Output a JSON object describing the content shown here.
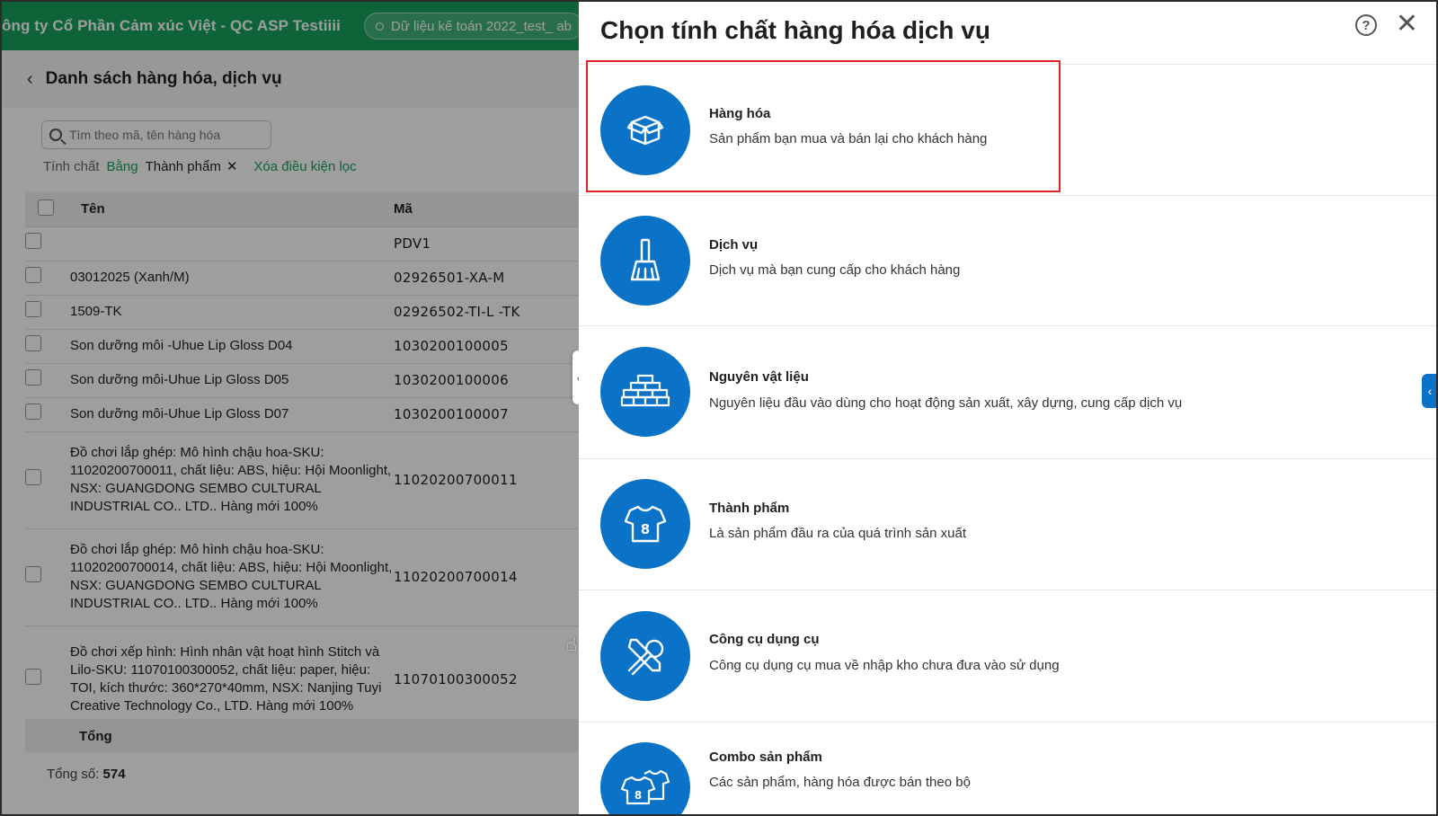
{
  "app": {
    "company": "ông ty Cổ Phần Cảm xúc Việt - QC ASP Testiiii",
    "database": "Dữ liệu kế toán 2022_test_ ab",
    "page_title": "Danh sách hàng hóa, dịch vụ",
    "search": {
      "placeholder": "Tìm theo mã, tên hàng hóa"
    },
    "filter": {
      "label": "Tính chất",
      "operator": "Bằng",
      "value": "Thành phẩm",
      "clear": "Xóa điều kiện lọc"
    },
    "columns": {
      "name": "Tên",
      "code": "Mã"
    },
    "rows": [
      {
        "name": "",
        "code": "PDV1"
      },
      {
        "name": "03012025 (Xanh/M)",
        "code": "02926501-XA-M"
      },
      {
        "name": "1509-TK",
        "code": "02926502-TI-L -TK"
      },
      {
        "name": "Son dưỡng môi -Uhue Lip Gloss D04",
        "code": "1030200100005"
      },
      {
        "name": "Son dưỡng môi-Uhue Lip Gloss D05",
        "code": "1030200100006"
      },
      {
        "name": "Son dưỡng môi-Uhue Lip Gloss D07",
        "code": "1030200100007"
      },
      {
        "name": "Đồ chơi lắp ghép: Mô hình chậu hoa-SKU: 11020200700011, chất liệu: ABS, hiệu: Hội Moonlight, NSX: GUANGDONG SEMBO CULTURAL INDUSTRIAL CO.. LTD.. Hàng mới 100%",
        "code": "11020200700011"
      },
      {
        "name": "Đồ chơi lắp ghép: Mô hình chậu hoa-SKU: 11020200700014, chất liệu: ABS, hiệu: Hội Moonlight, NSX: GUANGDONG SEMBO CULTURAL INDUSTRIAL CO.. LTD.. Hàng mới 100%",
        "code": "11020200700014"
      },
      {
        "name": "Đồ chơi xếp hình: Hình nhân vật hoạt hình Stitch và Lilo-SKU: 11070100300052, chất liệu: paper, hiệu: TOI, kích thước: 360*270*40mm, NSX: Nanjing Tuyi Creative Technology Co., LTD. Hàng mới 100%",
        "code": "11070100300052"
      }
    ],
    "total_label": "Tổng",
    "count_label": "Tổng số:",
    "count_value": "574"
  },
  "drawer": {
    "title": "Chọn tính chất hàng hóa dịch vụ",
    "options": [
      {
        "name": "Hàng hóa",
        "desc": "Sản phẩm bạn mua và bán lại cho khách hàng",
        "icon": "box-icon"
      },
      {
        "name": "Dịch vụ",
        "desc": "Dịch vụ mà bạn cung cấp cho khách hàng",
        "icon": "broom-icon"
      },
      {
        "name": "Nguyên vật liệu",
        "desc": "Nguyên liệu đầu vào dùng cho hoạt động sản xuất, xây dựng, cung cấp dịch vụ",
        "icon": "bricks-icon"
      },
      {
        "name": "Thành phẩm",
        "desc": "Là sản phẩm đầu ra của quá trình sản xuất",
        "icon": "shirt-icon"
      },
      {
        "name": "Công cụ dụng cụ",
        "desc": "Công cụ dụng cụ mua về nhập kho chưa đưa vào sử dụng",
        "icon": "tools-icon"
      },
      {
        "name": "Combo sản phẩm",
        "desc": "Các sản phẩm, hàng hóa được bán theo bộ",
        "icon": "shirts-combo-icon"
      }
    ]
  },
  "colors": {
    "brand_green": "#18a15d",
    "icon_blue": "#0a73c7",
    "highlight_red": "#e0242b"
  }
}
